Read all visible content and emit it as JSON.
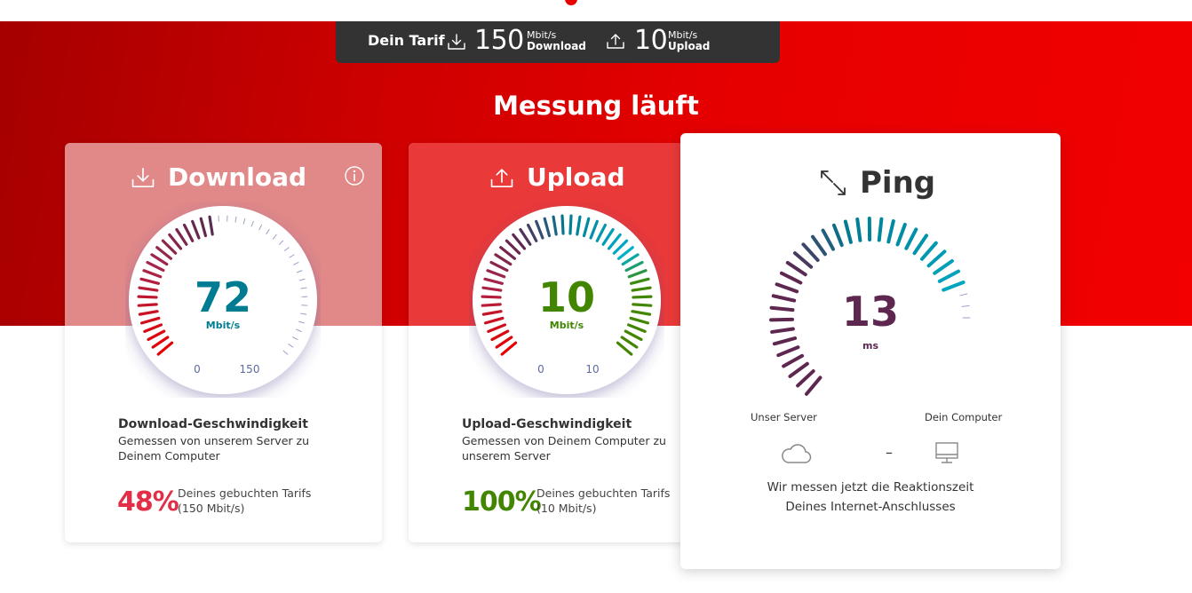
{
  "header": {
    "tarif_label": "Dein Tarif",
    "download_value": "150",
    "download_unit": "Mbit/s",
    "download_label": "Download",
    "upload_value": "10",
    "upload_unit": "Mbit/s",
    "upload_label": "Upload"
  },
  "page_title": "Messung läuft",
  "download": {
    "title": "Download",
    "value": "72",
    "unit": "Mbit/s",
    "scale_min": "0",
    "scale_max": "150",
    "fraction": 0.48,
    "desc_title": "Download-Geschwindigkeit",
    "desc": "Gemessen von unserem Server zu Deinem Computer",
    "desc_line1": "Gemessen von unserem Server zu",
    "desc_line2": "Deinem Computer",
    "percent": "48%",
    "percent_line1": "Deines gebuchten Tarifs",
    "percent_line2": "(150 Mbit/s)"
  },
  "upload": {
    "title": "Upload",
    "value": "10",
    "unit": "Mbit/s",
    "scale_min": "0",
    "scale_max": "10",
    "fraction": 1.0,
    "desc_title": "Upload-Geschwindigkeit",
    "desc_line1": "Gemessen von Deinem Computer zu",
    "desc_line2": "unserem Server",
    "percent": "100%",
    "percent_line1": "Deines gebuchten Tarifs",
    "percent_line2": "(10 Mbit/s)"
  },
  "ping": {
    "title": "Ping",
    "value": "13",
    "unit": "ms",
    "server_label": "Unser Server",
    "computer_label": "Dein Computer",
    "separator": "–",
    "msg_line1": "Wir messen jetzt die Reaktionszeit",
    "msg_line2": "Deines Internet-Anschlusses"
  },
  "colors": {
    "brand_red": "#e60000",
    "header_dark": "#333333",
    "download_teal": "#007c92",
    "upload_green": "#428600",
    "ping_purple": "#5e2750",
    "percent_red": "#e22e46"
  },
  "icons": [
    "download-icon",
    "upload-icon",
    "info-icon",
    "ping-arrows-icon",
    "cloud-icon",
    "monitor-icon"
  ]
}
